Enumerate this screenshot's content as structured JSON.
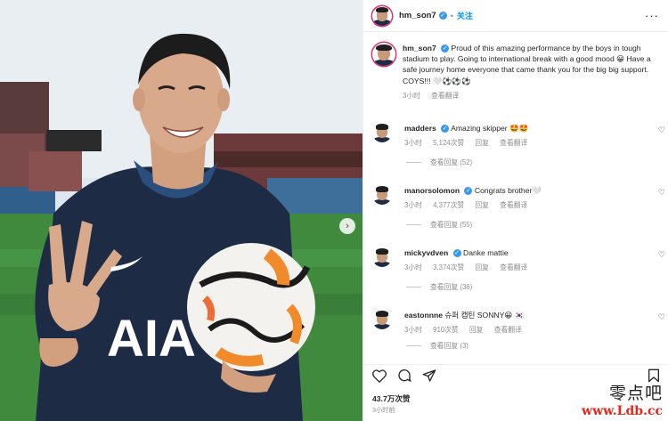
{
  "post": {
    "author": "hm_son7",
    "follow_label": "关注",
    "separator": "•",
    "more_label": "···",
    "caption": "Proud of this amazing performance by the boys in tough stadium to play. Going to international break with a good mood 😀 Have a safe journey home everyone that came thank you for the big big support. COYS!!! 🤍⚽⚽⚽",
    "caption_time": "3小时",
    "translate_label": "查看翻译",
    "likes": "43.7万次赞",
    "posted_time": "3小时前",
    "next_arrow": "›"
  },
  "photo": {
    "shirt_sponsor": "AIA"
  },
  "comments": [
    {
      "user": "madders",
      "text": "Amazing skipper 🤩🤩",
      "time": "3小时",
      "likes": "5,124次赞",
      "reply_label": "回复",
      "translate_label": "查看翻译",
      "replies": "查看回复 (52)"
    },
    {
      "user": "manorsolomon",
      "text": "Congrats brother🤍",
      "time": "3小时",
      "likes": "4,377次赞",
      "reply_label": "回复",
      "translate_label": "查看翻译",
      "replies": "查看回复 (55)"
    },
    {
      "user": "mickyvdven",
      "text": "Danke mattie",
      "time": "3小时",
      "likes": "3,374次赞",
      "reply_label": "回复",
      "translate_label": "查看翻译",
      "replies": "查看回复 (36)"
    },
    {
      "user": "eastonnne",
      "text": "슈퍼 캡틴 SONNY😀 🇰🇷",
      "time": "3小时",
      "likes": "910次赞",
      "reply_label": "回复",
      "translate_label": "查看翻译",
      "replies": "查看回复 (3)"
    }
  ],
  "watermark": {
    "cn": "零点吧",
    "url": "www.Ldb.cc"
  },
  "colors": {
    "verified": "#3897f0",
    "follow": "#0095f6",
    "muted": "#8e8e8e",
    "watermark_url": "#e0281c"
  },
  "icons": [
    "heart-icon",
    "comment-icon",
    "share-icon",
    "bookmark-icon",
    "verified-icon",
    "more-icon",
    "chevron-right-icon"
  ]
}
